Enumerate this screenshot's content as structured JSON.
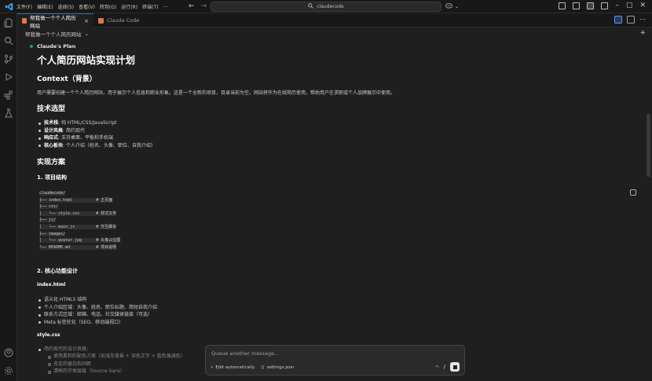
{
  "menu": [
    "文件(F)",
    "编辑(E)",
    "选择(S)",
    "查看(V)",
    "转到(G)",
    "运行(R)",
    "终端(T)",
    "…"
  ],
  "search": {
    "value": "claudecode"
  },
  "tabs": [
    {
      "label": "帮我做一个个人简历网站",
      "active": true
    },
    {
      "label": "Claude Code",
      "active": false
    }
  ],
  "breadcrumb": "帮我做一个个人简历网站",
  "plan": {
    "label": "Claude's Plan",
    "title": "个人简历网站实现计划",
    "context_heading": "Context（背景）",
    "context_text": "用户需要创建一个个人简历网站，用于展示个人信息和职业形象。这是一个全新的项目，目录当前为空。网站将作为在线简历使用，帮助用户在求职或个人品牌展示中使用。",
    "tech_heading": "技术选型",
    "tech_items": [
      {
        "key": "技术栈",
        "value": ": 纯 HTML/CSS/JavaScript"
      },
      {
        "key": "设计风格",
        "value": ": 简约现代"
      },
      {
        "key": "响应式",
        "value": ": 支持桌面、平板和手机端"
      },
      {
        "key": "核心板块",
        "value": ": 个人介绍（姓名、头像、职位、自我介绍）"
      }
    ],
    "impl_heading": "实现方案",
    "structure_heading": "1. 项目结构",
    "code_lines": [
      "claudecode/",
      "├── index.html          # 主页面",
      "├── css/",
      "│   └── style.css       # 样式文件",
      "├── js/",
      "│   └── main.js         # 交互脚本",
      "├── images/",
      "│   └── avatar.jpg      # 头像占位图",
      "└── README.md           # 项目说明"
    ],
    "core_heading": "2. 核心功能设计",
    "index_heading": "index.html",
    "index_items": [
      "语义化 HTML5 结构",
      "个人介绍区域：头像、姓名、职位标题、简短自我介绍",
      "联系方式区域：邮箱、电话、社交媒体链接（可选）",
      "Meta 标签优化（SEO、移动端视口）"
    ],
    "style_heading": "style.css",
    "style_items": [
      "简约现代的设计风格:"
    ],
    "style_sub_items": [
      "使用柔和的配色方案（如浅灰背景 + 深色文字 + 蓝色强调色）",
      "充足的留白和间距",
      "清晰的字体层级（Source Sans）"
    ]
  },
  "chat": {
    "placeholder": "Queue another message...",
    "mode": "Edit automatically",
    "file": "settings.json"
  },
  "colors": {
    "accent": "#0078d4",
    "claude": "#d97757",
    "background": "#1f1f1f"
  }
}
